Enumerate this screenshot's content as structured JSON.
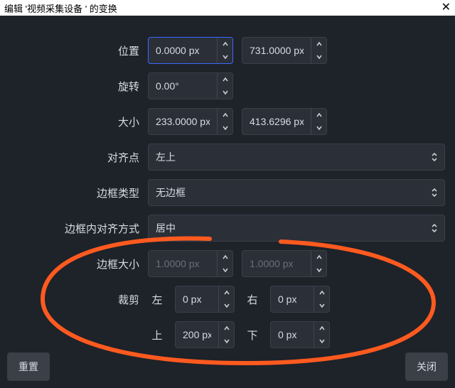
{
  "title": "编辑 '视频采集设备 ' 的变换",
  "labels": {
    "position": "位置",
    "rotation": "旋转",
    "size": "大小",
    "alignment": "对齐点",
    "boundingType": "边框类型",
    "boundingAlign": "边框内对齐方式",
    "boundingSize": "边框大小",
    "crop": "裁剪",
    "left": "左",
    "right": "右",
    "top": "上",
    "bottom": "下"
  },
  "values": {
    "posX": "0.0000 px",
    "posY": "731.0000 px",
    "rotation": "0.00°",
    "sizeW": "233.0000 px",
    "sizeH": "413.6296 px",
    "alignment": "左上",
    "boundingType": "无边框",
    "boundingAlign": "居中",
    "bsW": "1.0000 px",
    "bsH": "1.0000 px",
    "cropL": "0 px",
    "cropR": "0 px",
    "cropT": "200 px",
    "cropB": "0 px"
  },
  "buttons": {
    "reset": "重置",
    "close": "关闭"
  }
}
